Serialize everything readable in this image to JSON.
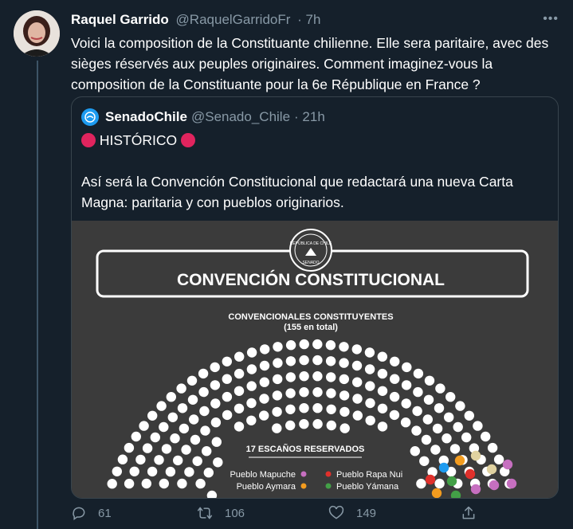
{
  "tweet": {
    "author_name": "Raquel Garrido",
    "author_handle": "@RaquelGarridoFr",
    "time": "· 7h",
    "text": "Voici la composition de la Constituante chilienne. Elle sera paritaire, avec des sièges réservés aux peuples originaires. Comment imaginez-vous la composition de la Constituante pour la 6e République en France ?"
  },
  "quote": {
    "author_name": "SenadoChile",
    "author_handle": "@Senado_Chile",
    "time": "· 21h",
    "line1": "HISTÓRICO",
    "line2": "Así será la Convención Constitucional que redactará una nueva Carta Magna: paritaria y con pueblos originarios."
  },
  "image": {
    "seal_top": "REPÚBLICA DE CHILE",
    "seal_bottom": "SENADO",
    "title": "CONVENCIÓN CONSTITUCIONAL",
    "subtitle": "CONVENCIONALES CONSTITUYENTES",
    "subtitle2": "(155 en total)",
    "reserved_label": "17 ESCAÑOS  RESERVADOS",
    "legend": [
      {
        "label": "Pueblo Mapuche",
        "color": "#c66fc0"
      },
      {
        "label": "Pueblo Aymara",
        "color": "#f39c1f"
      },
      {
        "label": "Pueblo Rapa Nui",
        "color": "#e0302b"
      },
      {
        "label": "Pueblo Yámana",
        "color": "#43a047"
      }
    ],
    "seat_color": "#ffffff",
    "background": "#3b3b3b"
  },
  "actions": {
    "replies": "61",
    "retweets": "106",
    "likes": "149"
  },
  "icons": [
    "more-icon",
    "reply-icon",
    "retweet-icon",
    "like-icon",
    "share-icon"
  ],
  "colors": {
    "background": "#15202b",
    "secondary_text": "#8899a6",
    "border": "#38444d",
    "red_circle": "#e0245e"
  }
}
